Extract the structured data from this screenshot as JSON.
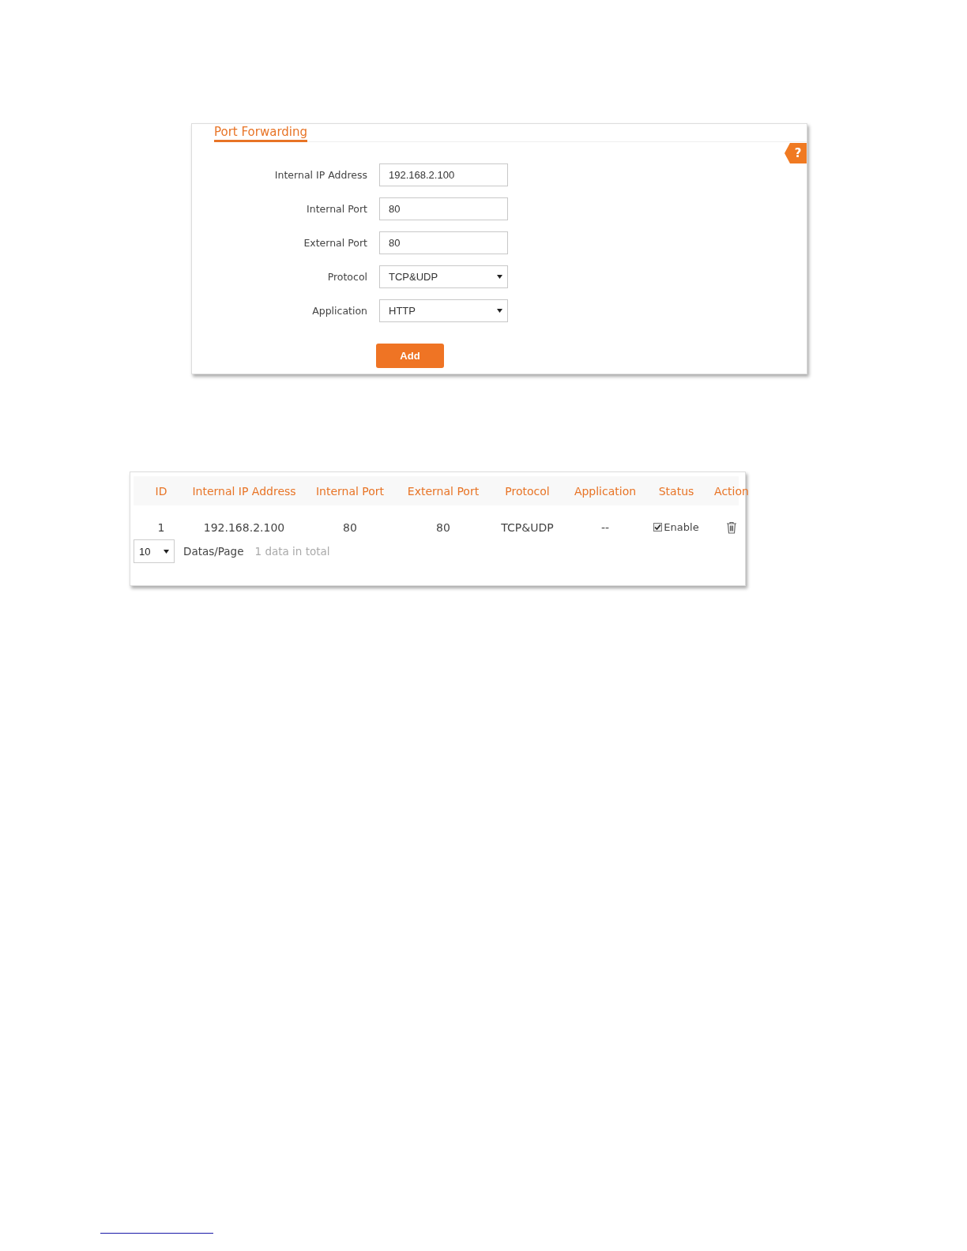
{
  "port_forwarding_form": {
    "title": "Port Forwarding",
    "help_icon": "?",
    "fields": [
      {
        "kind": "text",
        "label": "Internal IP Address",
        "value": "192.168.2.100"
      },
      {
        "kind": "text",
        "label": "Internal Port",
        "value": "80"
      },
      {
        "kind": "text",
        "label": "External Port",
        "value": "80"
      },
      {
        "kind": "select",
        "label": "Protocol",
        "value": "TCP&UDP"
      },
      {
        "kind": "select",
        "label": "Application",
        "value": "HTTP"
      }
    ],
    "add_button": "Add"
  },
  "rules_table": {
    "columns": [
      "ID",
      "Internal IP Address",
      "Internal Port",
      "External Port",
      "Protocol",
      "Application",
      "Status",
      "Action"
    ],
    "rows": [
      {
        "id": "1",
        "internal_ip": "192.168.2.100",
        "internal_port": "80",
        "external_port": "80",
        "protocol": "TCP&UDP",
        "application": "--",
        "status": {
          "label": "Enable",
          "checked": true
        }
      }
    ],
    "page_size": "10",
    "page_size_label": "Datas/Page",
    "total": "1 data in total"
  }
}
